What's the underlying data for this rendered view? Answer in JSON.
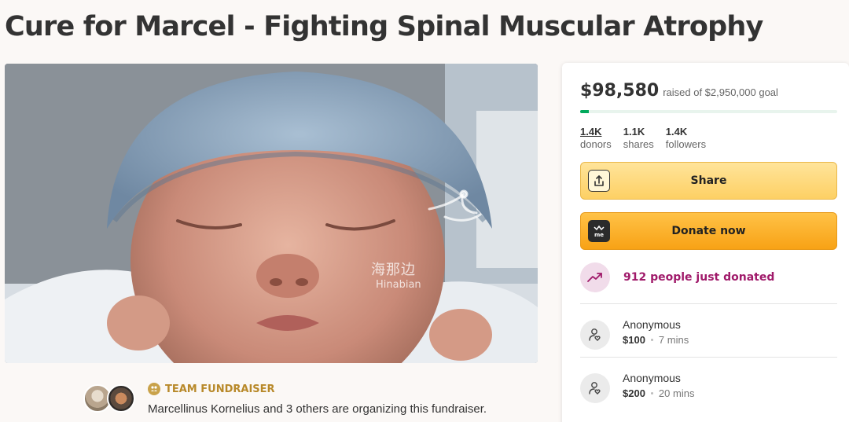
{
  "page": {
    "title": "Cure for Marcel - Fighting Spinal Muscular Atrophy"
  },
  "photo": {
    "watermark_cn": "海那边",
    "watermark_en": "Hinabian"
  },
  "team": {
    "badge": "TEAM FUNDRAISER",
    "description": "Marcellinus Kornelius and 3 others are organizing this fundraiser."
  },
  "progress": {
    "raised": "$98,580",
    "goal_text": "raised of $2,950,000 goal",
    "percent_funded": 3.3,
    "accent_color": "#02a95c"
  },
  "stats": [
    {
      "value": "1.4K",
      "label": "donors"
    },
    {
      "value": "1.1K",
      "label": "shares"
    },
    {
      "value": "1.4K",
      "label": "followers"
    }
  ],
  "buttons": {
    "share_label": "Share",
    "donate_label": "Donate now",
    "donate_icon_text": "me"
  },
  "activity": {
    "recent_donors_text": "912 people just donated",
    "accent_color": "#a01a6a"
  },
  "donations": [
    {
      "name": "Anonymous",
      "amount": "$100",
      "time": "7 mins"
    },
    {
      "name": "Anonymous",
      "amount": "$200",
      "time": "20 mins"
    }
  ],
  "icons": {
    "share": "share-upload-icon",
    "donate": "gofundme-logo-icon",
    "trend": "trending-up-icon",
    "donor": "donor-heart-icon",
    "team": "team-icon"
  }
}
